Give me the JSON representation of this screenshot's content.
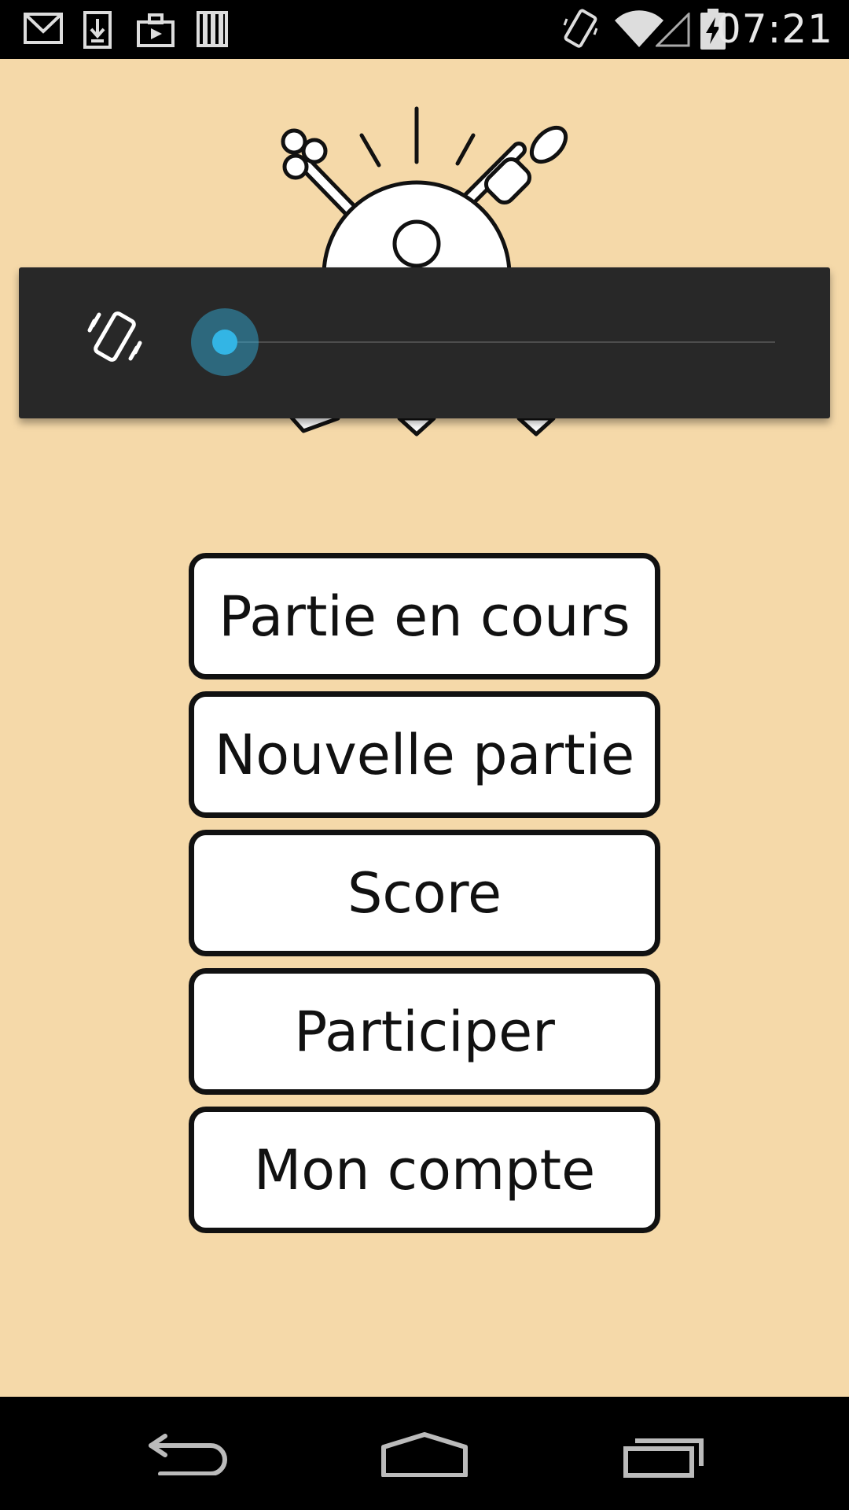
{
  "status_bar": {
    "time": "07:21",
    "left_icons": [
      "gmail-icon",
      "download-icon",
      "briefcase-icon",
      "library-icon"
    ],
    "right_icons": [
      "vibrate-icon",
      "wifi-icon",
      "signal-icon",
      "battery-charging-icon"
    ]
  },
  "volume_panel": {
    "mode_icon": "vibrate-icon",
    "level": 0,
    "accent_color": "#33b5e5"
  },
  "menu": {
    "buttons": [
      {
        "label": "Partie en cours"
      },
      {
        "label": "Nouvelle partie"
      },
      {
        "label": "Score"
      },
      {
        "label": "Participer"
      },
      {
        "label": "Mon compte"
      }
    ]
  },
  "nav_bar": {
    "buttons": [
      "back-icon",
      "home-icon",
      "recent-apps-icon"
    ]
  },
  "colors": {
    "background": "#f5d9a9",
    "panel": "#282828"
  }
}
